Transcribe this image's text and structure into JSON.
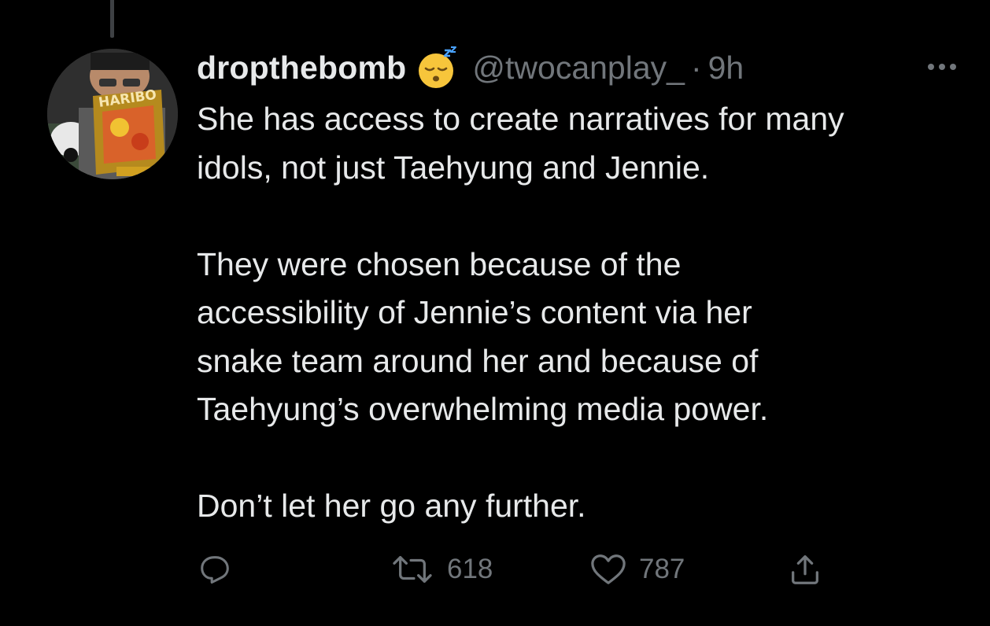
{
  "tweet": {
    "display_name": "dropthebomb",
    "name_emoji": "sleeping-face-emoji",
    "handle": "@twocanplay_",
    "separator": "·",
    "time": "9h",
    "text": "She has access to create narratives for many\nidols, not just Taehyung and Jennie.\n\nThey were chosen because of the\naccessibility of Jennie’s content via her\nsnake team around her and because of\nTaehyung’s overwhelming media power.\n\nDon’t let her go any further.",
    "avatar_text": "HARIBO"
  },
  "actions": {
    "reply_icon": "reply-icon",
    "retweet_icon": "retweet-icon",
    "retweet_count": "618",
    "like_icon": "heart-icon",
    "like_count": "787",
    "share_icon": "share-icon"
  },
  "colors": {
    "background": "#000000",
    "text_primary": "#e7e9ea",
    "text_secondary": "#71767b",
    "thread_line": "#3e4144"
  }
}
